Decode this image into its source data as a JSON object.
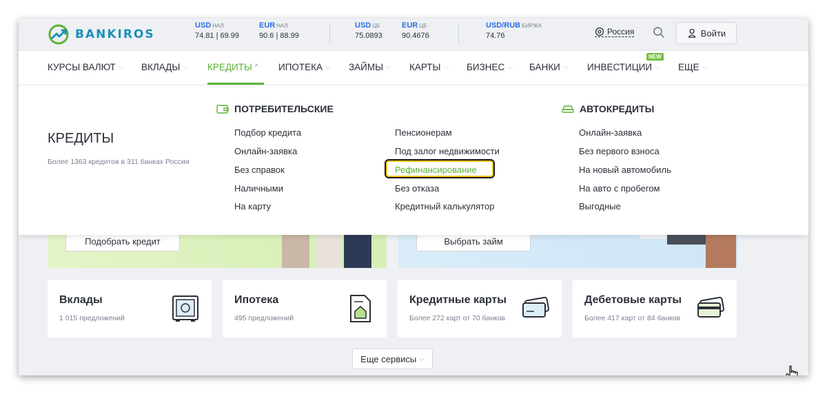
{
  "brand": {
    "name": "BANKIROS",
    "accent": "#5bb336",
    "brand_color": "#1c8fb7"
  },
  "rates": [
    {
      "label": "USD",
      "suffix": "НАЛ",
      "value": "74.81 | 69.99"
    },
    {
      "label": "EUR",
      "suffix": "НАЛ",
      "value": "90.6 | 88.99"
    },
    {
      "label": "USD",
      "suffix": "ЦБ",
      "value": "75.0893"
    },
    {
      "label": "EUR",
      "suffix": "ЦБ",
      "value": "90.4676"
    },
    {
      "label": "USD/RUB",
      "suffix": "БИРЖА",
      "value": "74.76"
    }
  ],
  "header": {
    "region": "Россия",
    "login": "Войти",
    "icons": [
      "location-icon",
      "search-icon",
      "user-icon"
    ]
  },
  "nav": {
    "items": [
      "КУРСЫ ВАЛЮТ",
      "ВКЛАДЫ",
      "КРЕДИТЫ",
      "ИПОТЕКА",
      "ЗАЙМЫ",
      "КАРТЫ",
      "БИЗНЕС",
      "БАНКИ",
      "ИНВЕСТИЦИИ",
      "ЕЩЕ"
    ],
    "active": "КРЕДИТЫ",
    "new_badge": "NEW"
  },
  "dropdown": {
    "title": "КРЕДИТЫ",
    "subtitle": "Более 1363 кредитов в 311 банках России",
    "consumer": {
      "heading": "ПОТРЕБИТЕЛЬСКИЕ",
      "col1": [
        "Подбор кредита",
        "Онлайн-заявка",
        "Без справок",
        "Наличными",
        "На карту"
      ],
      "col2": [
        "Пенсионерам",
        "Под залог недвижимости",
        "Рефинансирование",
        "Без отказа",
        "Кредитный калькулятор"
      ]
    },
    "auto": {
      "heading": "АВТОКРЕДИТЫ",
      "links": [
        "Онлайн-заявка",
        "Без первого взноса",
        "На новый автомобиль",
        "На авто с пробегом",
        "Выгодные"
      ]
    },
    "highlighted": "Рефинансирование"
  },
  "banners": {
    "left_button": "Подобрать кредит",
    "right_button": "Выбрать займ"
  },
  "services": [
    {
      "title": "Вклады",
      "sub": "1 015 предложений",
      "icon": "safe-icon"
    },
    {
      "title": "Ипотека",
      "sub": "495 предложений",
      "icon": "house-document-icon"
    },
    {
      "title": "Кредитные карты",
      "sub": "Более 272 карт от 70 банков",
      "icon": "credit-card-icon"
    },
    {
      "title": "Дебетовые карты",
      "sub": "Более 417 карт от 84 банков",
      "icon": "debit-card-icon"
    }
  ],
  "more_services": "Еще сервисы"
}
